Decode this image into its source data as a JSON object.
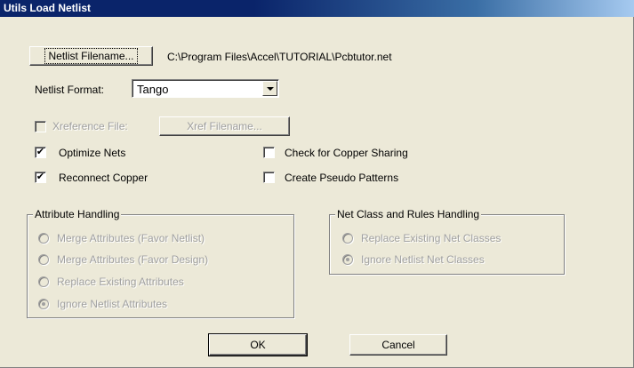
{
  "window": {
    "title": "Utils Load Netlist"
  },
  "netlist": {
    "button_label": "Netlist Filename...",
    "path": "C:\\Program Files\\Accel\\TUTORIAL\\Pcbtutor.net"
  },
  "format": {
    "label": "Netlist Format:",
    "value": "Tango"
  },
  "xref": {
    "checkbox_label": "Xreference File:",
    "button_label": "Xref Filename...",
    "enabled": false
  },
  "options": {
    "optimize_nets": {
      "label": "Optimize Nets",
      "checked": true
    },
    "reconnect_copper": {
      "label": "Reconnect Copper",
      "checked": true
    },
    "check_copper_sharing": {
      "label": "Check for Copper Sharing",
      "checked": false
    },
    "create_pseudo_patterns": {
      "label": "Create Pseudo Patterns",
      "checked": false
    }
  },
  "attribute_handling": {
    "title": "Attribute Handling",
    "options": [
      {
        "label": "Merge Attributes (Favor Netlist)",
        "selected": false
      },
      {
        "label": "Merge Attributes (Favor Design)",
        "selected": false
      },
      {
        "label": "Replace Existing Attributes",
        "selected": false
      },
      {
        "label": "Ignore Netlist Attributes",
        "selected": true
      }
    ]
  },
  "net_class_handling": {
    "title": "Net Class and Rules Handling",
    "options": [
      {
        "label": "Replace Existing Net Classes",
        "selected": false
      },
      {
        "label": "Ignore Netlist Net Classes",
        "selected": true
      }
    ]
  },
  "footer": {
    "ok_label": "OK",
    "cancel_label": "Cancel"
  }
}
